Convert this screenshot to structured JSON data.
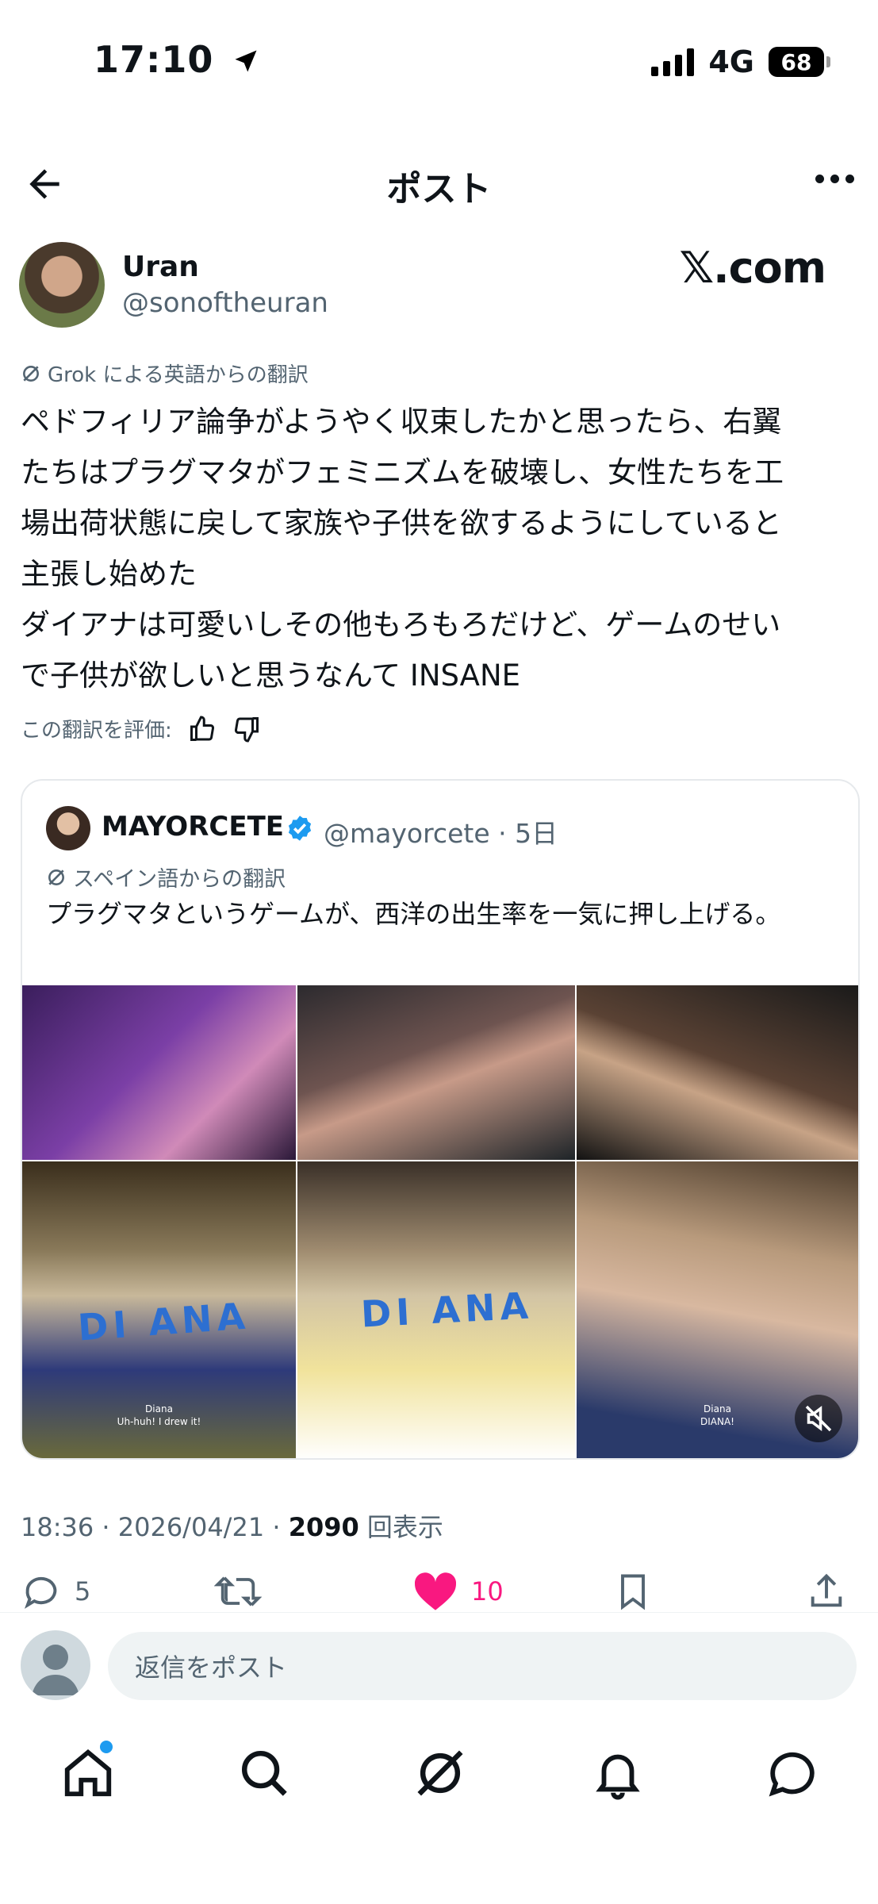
{
  "status_bar": {
    "time": "17:10",
    "network": "4G",
    "battery": "68"
  },
  "header": {
    "title": "ポスト"
  },
  "author": {
    "name": "Uran",
    "handle": "@sonoftheuran",
    "watermark": "𝕏.com"
  },
  "tweet": {
    "translation_label": "Grok による英語からの翻訳",
    "text": "ペドフィリア論争がようやく収束したかと思ったら、右翼\nたちはプラグマタがフェミニズムを破壊し、女性たちを工\n場出荷状態に戻して家族や子供を欲するようにしていると\n主張し始めた\nダイアナは可愛いしその他もろもろだけど、ゲームのせい\nで子供が欲しいと思うなんて INSANE",
    "rate_label": "この翻訳を評価:"
  },
  "quote": {
    "name": "MAYORCETE",
    "handle_date": "@mayorcete · 5日",
    "translation_label": "スペイン語からの翻訳",
    "text": "プラグマタというゲームが、西洋の出生率を一気に押し上げる。",
    "media": {
      "poster_text_left": "DI ANA",
      "poster_text_center": "DI ANA",
      "caption_left": "Diana\nUh-huh! I drew it!",
      "caption_right": "Diana\nDIANA!"
    }
  },
  "meta": {
    "time_date": "18:36 · 2026/04/21 · ",
    "views": "2090",
    "views_label": " 回表示"
  },
  "actions": {
    "replies": "5",
    "likes": "10"
  },
  "reply": {
    "placeholder": "返信をポスト"
  },
  "colors": {
    "accent": "#1d9bf0",
    "like": "#f91880",
    "text": "#0f1419",
    "secondary": "#536471"
  },
  "icons": [
    "back-arrow-icon",
    "more-icon",
    "grok-icon",
    "thumb-up-icon",
    "thumb-down-icon",
    "verified-icon",
    "mute-icon",
    "reply-icon",
    "retweet-icon",
    "heart-icon",
    "bookmark-icon",
    "share-icon",
    "home-icon",
    "search-icon",
    "grok-tab-icon",
    "bell-icon",
    "messages-icon"
  ]
}
